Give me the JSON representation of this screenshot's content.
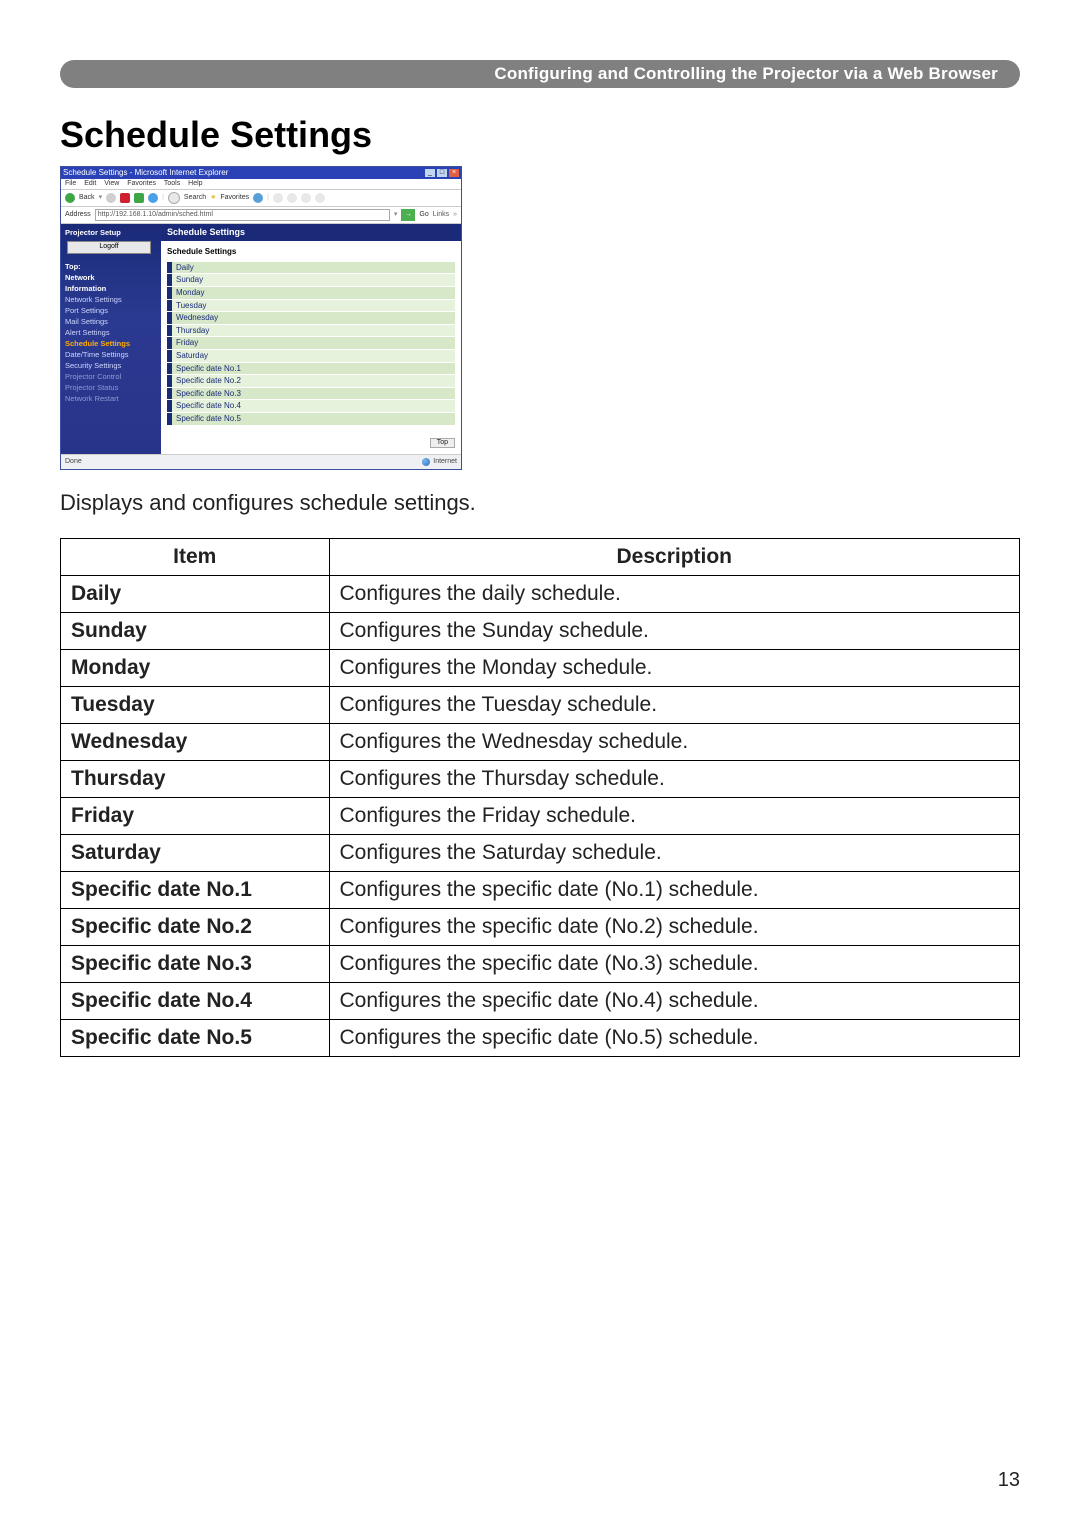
{
  "header_bar": "Configuring and Controlling the Projector via a Web Browser",
  "page_title": "Schedule Settings",
  "page_number": "13",
  "intro_text": "Displays and configures schedule settings.",
  "browser": {
    "window_title": "Schedule Settings - Microsoft Internet Explorer",
    "menu": {
      "m0": "File",
      "m1": "Edit",
      "m2": "View",
      "m3": "Favorites",
      "m4": "Tools",
      "m5": "Help"
    },
    "toolbar": {
      "back": "Back",
      "search": "Search",
      "favorites": "Favorites"
    },
    "address_label": "Address",
    "address_value": "http://192.168.1.10/admin/sched.html",
    "go": "Go",
    "links": "Links",
    "sidebar": {
      "brand": "Projector Setup",
      "logoff": "Logoff",
      "heading1": "Top:",
      "heading2": "Network",
      "heading3": "Information",
      "items": {
        "i0": "Network Settings",
        "i1": "Port Settings",
        "i2": "Mail Settings",
        "i3": "Alert Settings",
        "i4": "Schedule Settings",
        "i5": "Date/Time Settings",
        "i6": "Security Settings",
        "i7": "Projector Control",
        "i8": "Projector Status",
        "i9": "Network Restart"
      }
    },
    "content": {
      "title": "Schedule Settings",
      "subtitle": "Schedule Settings",
      "top_button": "Top",
      "rows": {
        "r0": "Daily",
        "r1": "Sunday",
        "r2": "Monday",
        "r3": "Tuesday",
        "r4": "Wednesday",
        "r5": "Thursday",
        "r6": "Friday",
        "r7": "Saturday",
        "r8": "Specific date No.1",
        "r9": "Specific date No.2",
        "r10": "Specific date No.3",
        "r11": "Specific date No.4",
        "r12": "Specific date No.5"
      }
    },
    "status": {
      "done": "Done",
      "zone": "Internet"
    }
  },
  "table": {
    "head_item": "Item",
    "head_desc": "Description",
    "rows": [
      {
        "item": "Daily",
        "desc": "Configures the daily schedule."
      },
      {
        "item": "Sunday",
        "desc": "Configures the Sunday schedule."
      },
      {
        "item": "Monday",
        "desc": "Configures the Monday schedule."
      },
      {
        "item": "Tuesday",
        "desc": "Configures the Tuesday schedule."
      },
      {
        "item": "Wednesday",
        "desc": "Configures the Wednesday schedule."
      },
      {
        "item": "Thursday",
        "desc": "Configures the Thursday schedule."
      },
      {
        "item": "Friday",
        "desc": "Configures the Friday schedule."
      },
      {
        "item": "Saturday",
        "desc": "Configures the Saturday schedule."
      },
      {
        "item": "Specific date No.1",
        "desc": "Configures the specific date (No.1) schedule."
      },
      {
        "item": "Specific date No.2",
        "desc": "Configures the specific date (No.2) schedule."
      },
      {
        "item": "Specific date No.3",
        "desc": "Configures the specific date (No.3) schedule."
      },
      {
        "item": "Specific date No.4",
        "desc": "Configures the specific date (No.4) schedule."
      },
      {
        "item": "Specific date No.5",
        "desc": "Configures the specific date (No.5) schedule."
      }
    ]
  }
}
